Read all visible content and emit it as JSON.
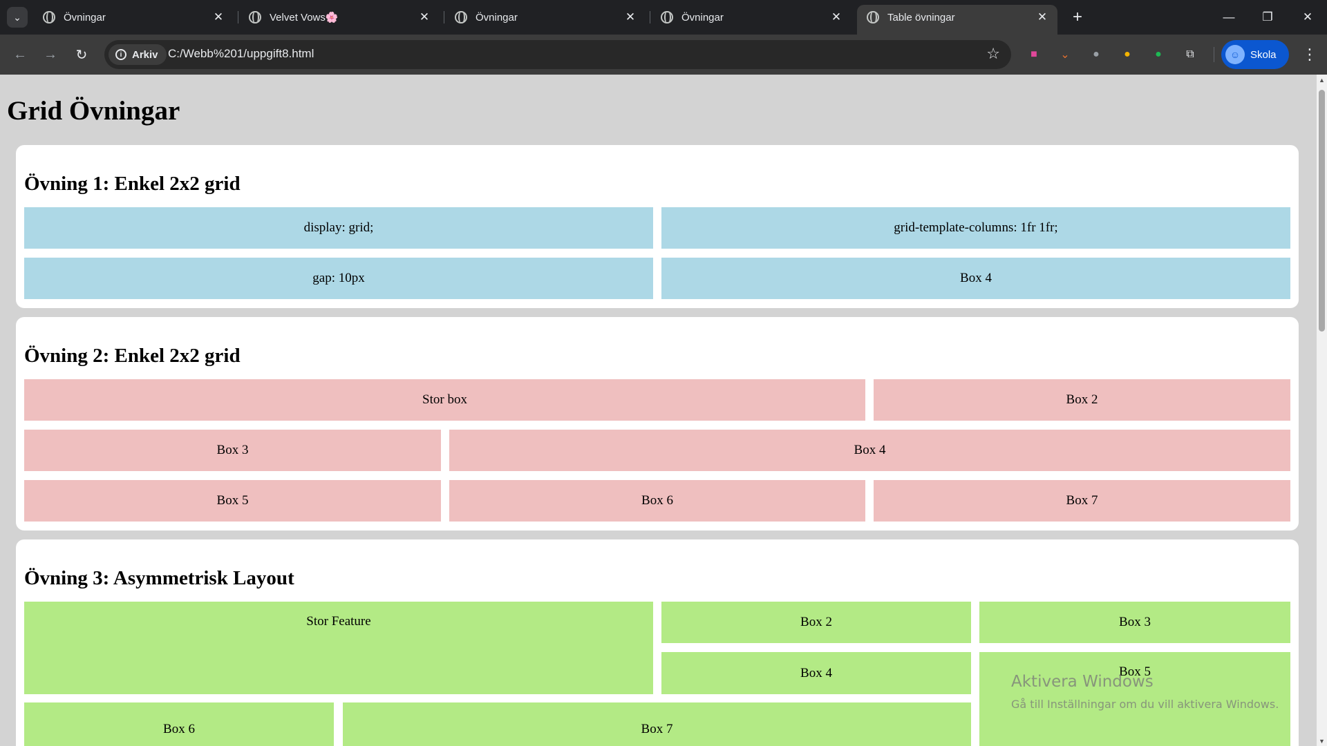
{
  "browser": {
    "tabs": [
      {
        "title": "Övningar",
        "favicon": "globe-icon"
      },
      {
        "title": "Velvet Vows🌸",
        "favicon": "globe-icon"
      },
      {
        "title": "Övningar",
        "favicon": "globe-icon"
      },
      {
        "title": "Övningar",
        "favicon": "globe-icon"
      },
      {
        "title": "Table övningar",
        "favicon": "globe-icon",
        "active": true
      }
    ],
    "address_chip": "Arkiv",
    "url": "C:/Webb%201/uppgift8.html",
    "profile_name": "Skola",
    "accent": "#0b57d0"
  },
  "page": {
    "title": "Grid Övningar",
    "sections": [
      {
        "heading": "Övning 1: Enkel 2x2 grid",
        "color": "#add8e6",
        "boxes": [
          "display: grid;",
          "grid-template-columns: 1fr 1fr;",
          "gap: 10px",
          "Box 4"
        ]
      },
      {
        "heading": "Övning 2: Enkel 2x2 grid",
        "color": "#efbfbf",
        "boxes": [
          "Stor box",
          "Box 2",
          "Box 3",
          "Box 4",
          "Box 5",
          "Box 6",
          "Box 7"
        ]
      },
      {
        "heading": "Övning 3: Asymmetrisk Layout",
        "color": "#b3ea85",
        "boxes": [
          "Stor Feature",
          "Box 2",
          "Box 3",
          "Box 4",
          "Box 5",
          "Box 6",
          "Box 7"
        ]
      }
    ]
  },
  "watermark": {
    "line1": "Aktivera Windows",
    "line2": "Gå till Inställningar om du vill aktivera Windows."
  }
}
